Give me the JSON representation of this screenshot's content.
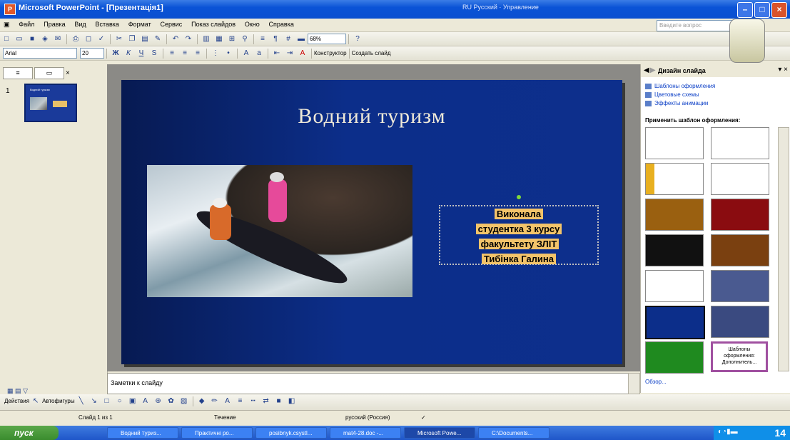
{
  "window": {
    "title": "Microsoft PowerPoint - [Презентація1]",
    "lang": "RU Русский",
    "lang2": "Управление",
    "close": "×"
  },
  "menu": [
    "Файл",
    "Правка",
    "Вид",
    "Вставка",
    "Формат",
    "Сервис",
    "Показ слайдов",
    "Окно",
    "Справка"
  ],
  "help_placeholder": "Введите вопрос",
  "toolbar": {
    "zoom": "68%",
    "font": "Arial",
    "size": "20",
    "designer": "Конструктор",
    "new_slide": "Создать слайд"
  },
  "outline": {
    "tab_close": "×",
    "thumb_number": "1",
    "thumb_title": "Водний туризм"
  },
  "slide": {
    "title": "Водний туризм",
    "text_lines": [
      "Виконала",
      "студентка 3 курсу",
      "факультету ЗЛІТ",
      "Тибінка Галина"
    ]
  },
  "notes": "Заметки к слайду",
  "task_pane": {
    "title": "Дизайн слайда",
    "links": [
      "Шаблоны оформления",
      "Цветовые схемы",
      "Эффекты анимации"
    ],
    "section": "Применить шаблон оформления:",
    "last_template": "Шаблоны оформления: Дополнитель...",
    "browse": "Обзор..."
  },
  "draw_toolbar": {
    "actions": "Действия",
    "autoshapes": "Автофигуры"
  },
  "status": {
    "slide": "Слайд 1 из 1",
    "design": "Течение",
    "language": "русский (Россия)"
  },
  "taskbar": {
    "start": "пуск",
    "tasks": [
      "Водний туриз...",
      "Практичні ро...",
      "posibnyk.csystl...",
      "mat4-28.doc -...",
      "Microsoft Powe...",
      "C:\\Documents..."
    ],
    "clock": "14"
  },
  "colors": {
    "slide_bg": "#0c2e8a",
    "title_text": "#f0ead8",
    "highlight": "#f3c46a",
    "titlebar": "#0a53d6"
  }
}
